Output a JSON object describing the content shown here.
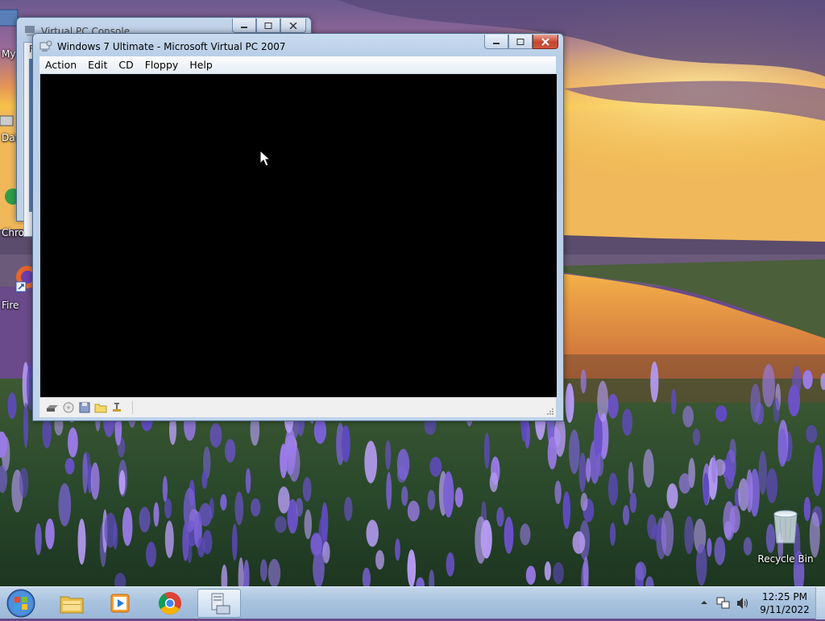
{
  "desktop": {
    "icons": [
      {
        "label": "My",
        "name": "my-computer"
      },
      {
        "label": "Dat",
        "name": "data"
      },
      {
        "label": "Chro",
        "name": "chrome"
      },
      {
        "label": "Fire",
        "name": "firefox"
      }
    ],
    "recycle_bin": {
      "label": "Recycle Bin"
    }
  },
  "console_window": {
    "title": "Virtual PC Console",
    "menu_fragment": "F"
  },
  "vpc_window": {
    "title": "Windows 7 Ultimate - Microsoft Virtual PC 2007",
    "menu": [
      "Action",
      "Edit",
      "CD",
      "Floppy",
      "Help"
    ],
    "status_icons": [
      "hard-disk-icon",
      "cd-drive-icon",
      "floppy-drive-icon",
      "shared-folder-icon",
      "network-icon"
    ]
  },
  "taskbar": {
    "pinned": [
      {
        "name": "explorer",
        "icon": "folder-icon"
      },
      {
        "name": "media-player",
        "icon": "media-player-icon"
      },
      {
        "name": "chrome",
        "icon": "chrome-icon"
      },
      {
        "name": "virtual-pc",
        "icon": "virtual-pc-icon",
        "active": true
      }
    ],
    "clock": {
      "time": "12:25 PM",
      "date": "9/11/2022"
    }
  },
  "colors": {
    "accent_close": "#c7442e",
    "taskbar": "#a9c3df",
    "vm_screen": "#000000"
  }
}
